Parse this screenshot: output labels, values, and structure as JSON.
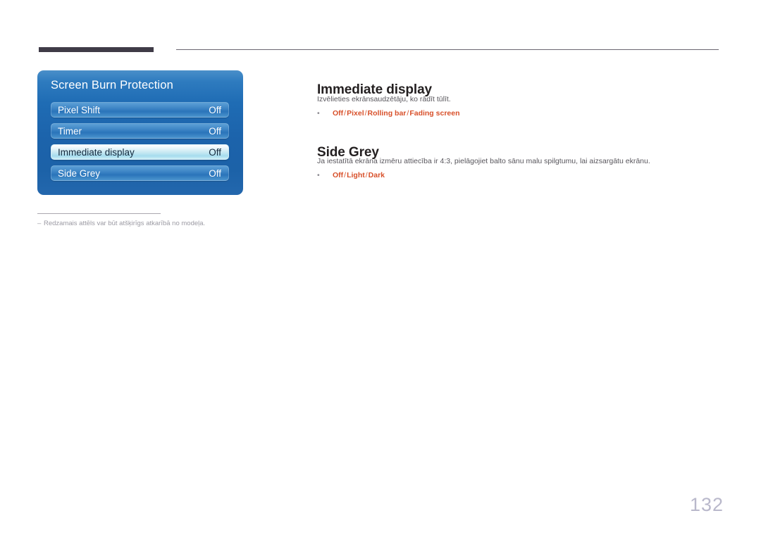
{
  "osd": {
    "title": "Screen Burn Protection",
    "rows": [
      {
        "label": "Pixel Shift",
        "value": "Off",
        "selected": false
      },
      {
        "label": "Timer",
        "value": "Off",
        "selected": false
      },
      {
        "label": "Immediate display",
        "value": "Off",
        "selected": true
      },
      {
        "label": "Side Grey",
        "value": "Off",
        "selected": false
      }
    ]
  },
  "footnote": {
    "dash": "–",
    "text": "Redzamais attēls var būt atšķirīgs atkarībā no modeļa."
  },
  "sections": [
    {
      "heading": "Immediate display",
      "body": "Izvēlieties ekrānsaudzētāju, ko rādīt tūlīt.",
      "bullet": "•",
      "options": [
        "Off",
        "Pixel",
        "Rolling bar",
        "Fading screen"
      ],
      "separator": "/"
    },
    {
      "heading": "Side Grey",
      "body": "Ja iestatītā ekrāna izmēru attiecība ir 4:3, pielāgojiet balto sānu malu spilgtumu, lai aizsargātu ekrānu.",
      "bullet": "•",
      "options": [
        "Off",
        "Light",
        "Dark"
      ],
      "separator": "/"
    }
  ],
  "page_number": "132",
  "colors": {
    "accent_orange": "#d8502a",
    "osd_blue": "#1c63ab",
    "top_rule_dark": "#3f3b47",
    "page_number": "#b9b8cb"
  }
}
